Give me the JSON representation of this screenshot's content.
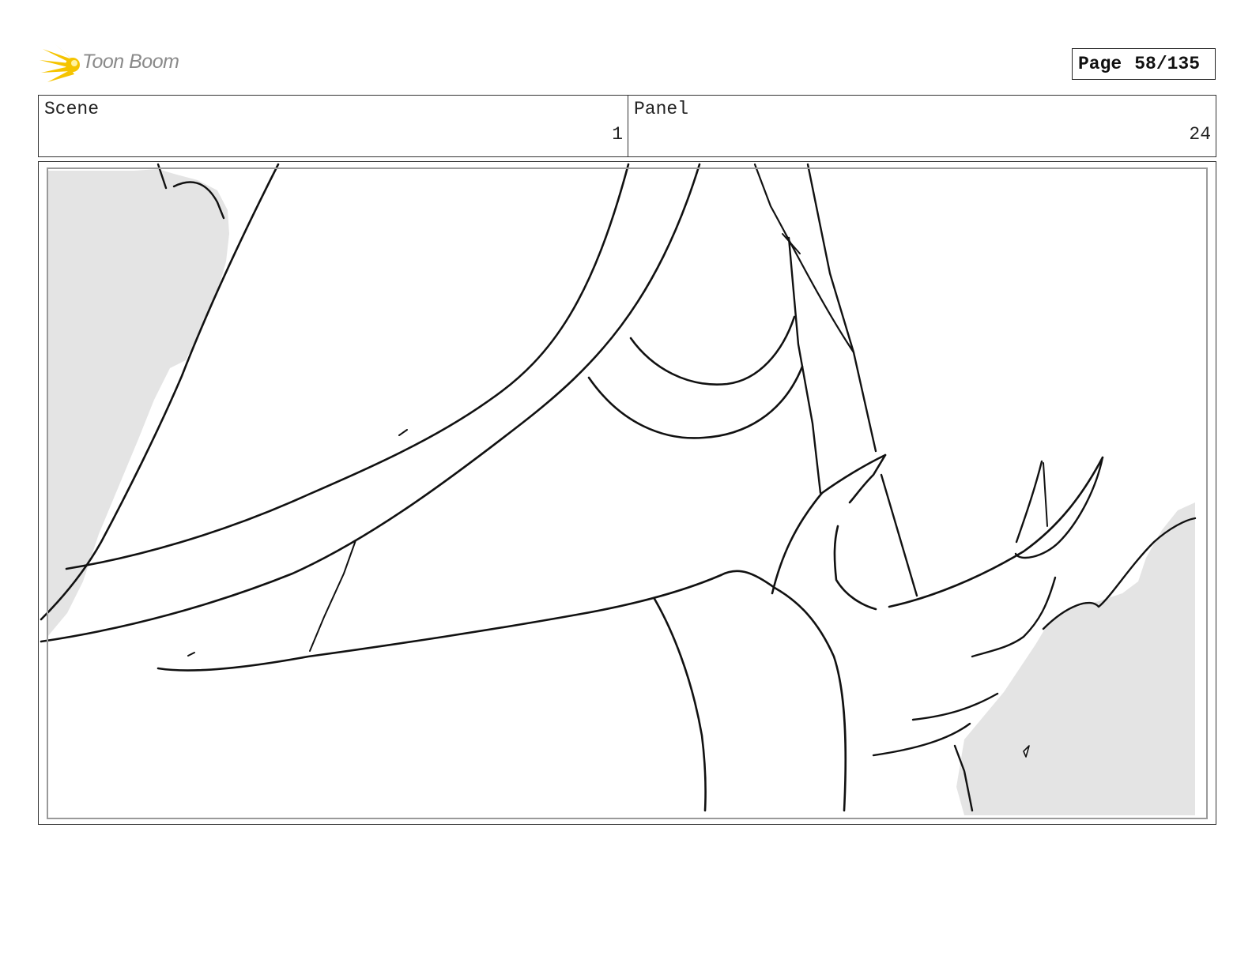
{
  "header": {
    "logo_text": "Toon Boom",
    "page_label": "Page",
    "page_value": "58/135"
  },
  "fields": {
    "scene_label": "Scene",
    "scene_value": "1",
    "panel_label": "Panel",
    "panel_value": "24"
  },
  "colors": {
    "logo_accent": "#f5c400",
    "logo_text": "#8a8a8a",
    "sketch_line": "#111111",
    "background_fill": "#e4e4e4",
    "frame_border": "#9a9a9a"
  },
  "icons": {
    "logo": "starburst-icon"
  }
}
